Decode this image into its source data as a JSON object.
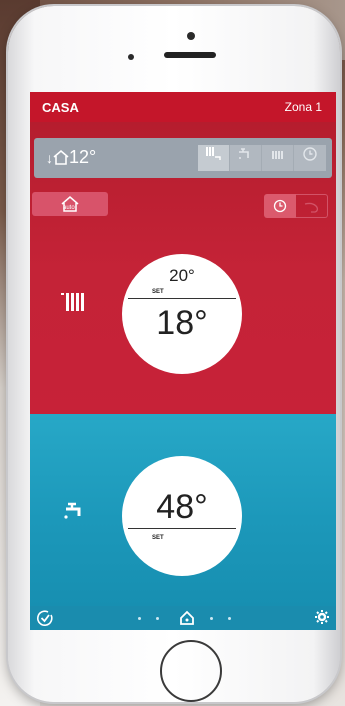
{
  "app": {
    "title": "CASA",
    "zone": "Zona 1"
  },
  "info_bar": {
    "outdoor_temp": "12°",
    "modes": [
      {
        "name": "heating-and-hot-water",
        "active": true
      },
      {
        "name": "hot-water",
        "active": false
      },
      {
        "name": "heating",
        "active": false
      },
      {
        "name": "schedule",
        "active": false
      }
    ]
  },
  "auto_button": {
    "label": "auto"
  },
  "program_toggle": {
    "options": [
      {
        "name": "schedule-mode",
        "active": true
      },
      {
        "name": "manual-mode",
        "active": false
      }
    ]
  },
  "heating": {
    "icon": "radiator-icon",
    "set_value": "20°",
    "set_label": "SET",
    "current_value": "18°"
  },
  "hot_water": {
    "icon": "tap-icon",
    "value": "48°",
    "set_label": "SET"
  },
  "footer": {
    "left_icon": "check-icon",
    "center_icon": "home-icon",
    "right_icon": "gear-icon"
  },
  "colors": {
    "header": "#c4162a",
    "heating_bg": "#c42337",
    "hot_water_bg": "#1c98ba",
    "info_bar": "#9aa3ad"
  }
}
